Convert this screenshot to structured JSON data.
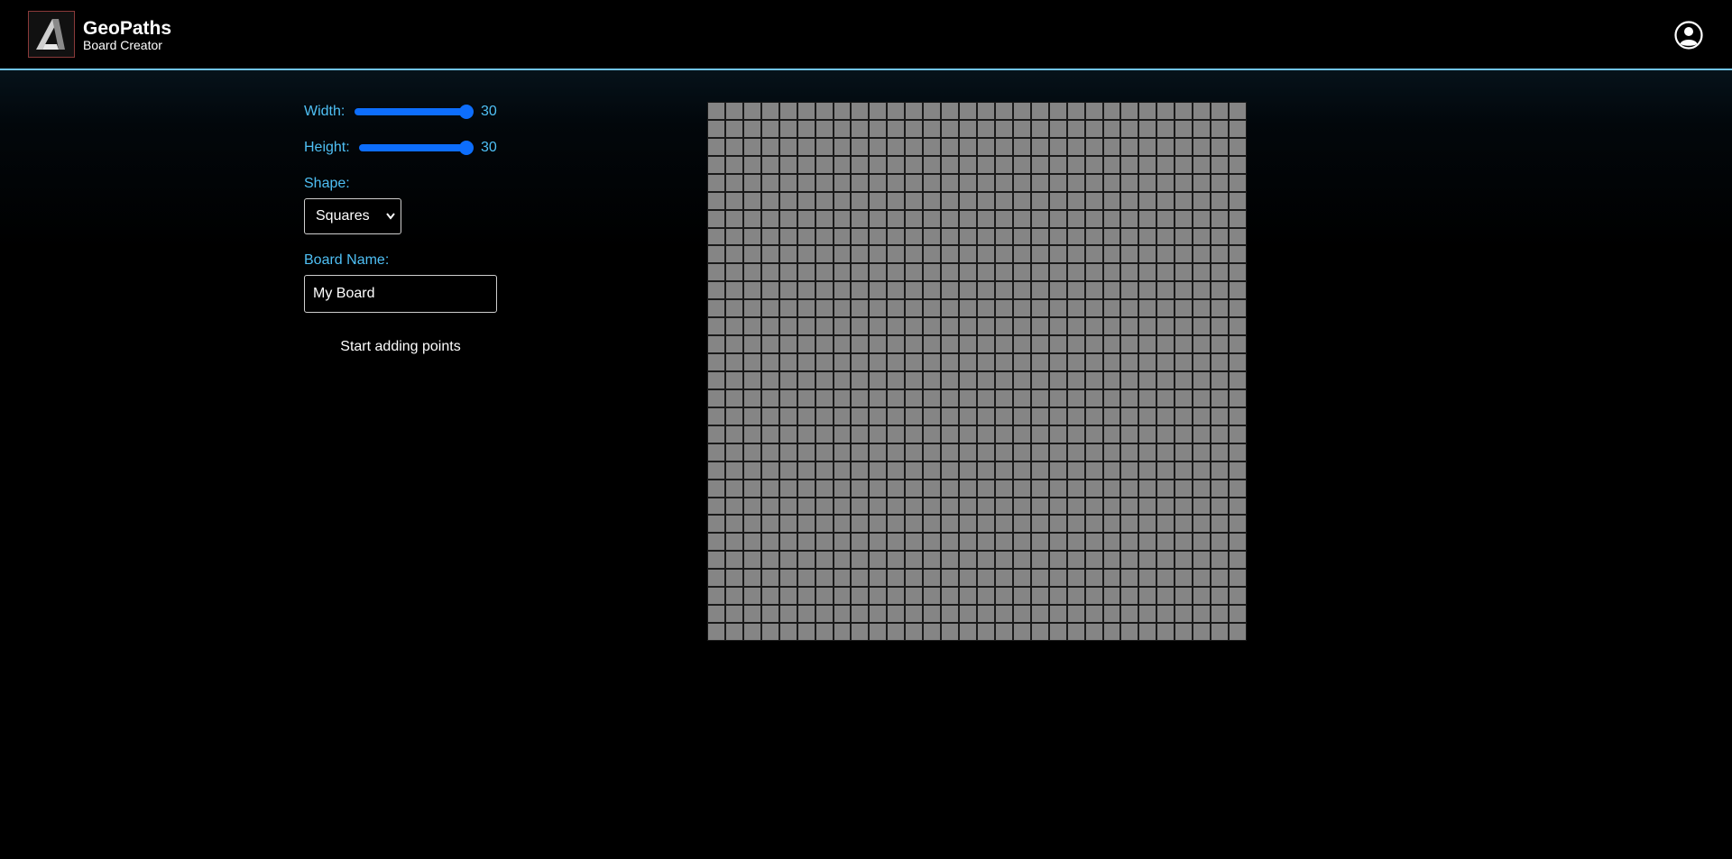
{
  "header": {
    "brand_title": "GeoPaths",
    "brand_subtitle": "Board Creator",
    "logo_icon": "geopaths-logo-icon",
    "account_icon": "user-account-icon"
  },
  "controls": {
    "width_label": "Width:",
    "width_value": "30",
    "width_fraction": 1.0,
    "height_label": "Height:",
    "height_value": "30",
    "height_fraction": 1.0,
    "shape_label": "Shape:",
    "shape_selected": "Squares",
    "board_name_label": "Board Name:",
    "board_name_value": "My Board",
    "start_button": "Start adding points"
  },
  "board": {
    "columns": 30,
    "rows": 30,
    "cell_color": "#858585",
    "line_color": "#1a1a1a"
  },
  "colors": {
    "accent": "#4fc0f5",
    "slider": "#0d6efd",
    "header_border": "#6fc3e6"
  }
}
